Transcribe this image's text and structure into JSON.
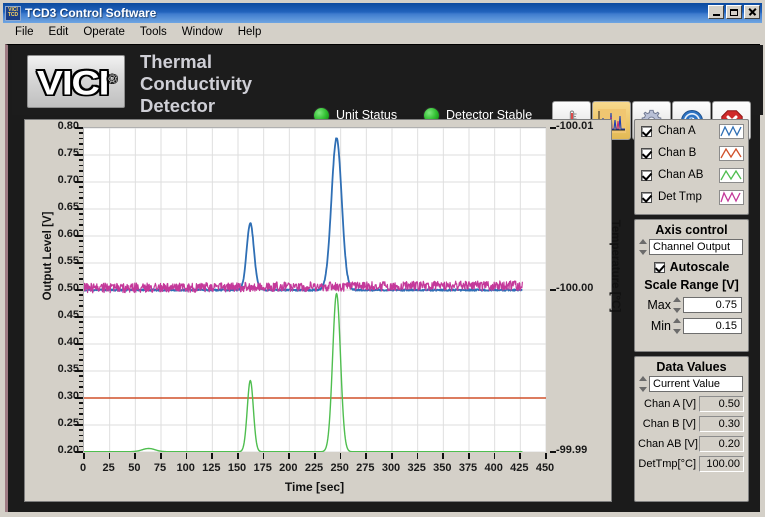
{
  "window": {
    "title": "TCD3 Control Software",
    "icon": "vici-tcd-icon",
    "minimize_label": "Minimize",
    "maximize_label": "Maximize",
    "close_label": "Close"
  },
  "menu": {
    "items": [
      {
        "label": "File"
      },
      {
        "label": "Edit"
      },
      {
        "label": "Operate"
      },
      {
        "label": "Tools"
      },
      {
        "label": "Window"
      },
      {
        "label": "Help"
      }
    ]
  },
  "banner": {
    "logo_text": "VICI",
    "logo_reg": "®",
    "product_title": "Thermal Conductivity Detector",
    "leds": [
      {
        "label": "Unit Status",
        "color": "#36c236"
      },
      {
        "label": "Detector Stable",
        "color": "#36c236"
      }
    ],
    "toolbar": [
      {
        "name": "temperature-button",
        "label": "Temperature"
      },
      {
        "name": "chromatogram-button",
        "label": "Chromatogram"
      },
      {
        "name": "settings-button",
        "label": "Settings"
      },
      {
        "name": "help-button",
        "label": "Help"
      },
      {
        "name": "close-app-button",
        "label": "Exit"
      }
    ]
  },
  "channels": {
    "items": [
      {
        "label": "Chan A",
        "checked": true,
        "color": "#2f6fb5"
      },
      {
        "label": "Chan B",
        "checked": true,
        "color": "#d1512a"
      },
      {
        "label": "Chan AB",
        "checked": true,
        "color": "#4fbe4f"
      },
      {
        "label": "Det Tmp",
        "checked": true,
        "color": "#c4399a"
      }
    ]
  },
  "axis_control": {
    "title": "Axis control",
    "selector_value": "Channel Output",
    "autoscale_label": "Autoscale",
    "autoscale_checked": true,
    "scale_range_label": "Scale Range [V]",
    "max_label": "Max",
    "max_value": "0.75",
    "min_label": "Min",
    "min_value": "0.15"
  },
  "data_values": {
    "title": "Data Values",
    "selector_value": "Current Value",
    "rows": [
      {
        "label": "Chan A [V]",
        "value": "0.50"
      },
      {
        "label": "Chan B [V]",
        "value": "0.30"
      },
      {
        "label": "Chan AB [V]",
        "value": "0.20"
      },
      {
        "label": "DetTmp[°C]",
        "value": "100.00"
      }
    ]
  },
  "chart_data": {
    "type": "line",
    "title": "",
    "xlabel": "Time [sec]",
    "ylabel": "Output Level [V]",
    "y2label": "Temperature [°C]",
    "xlim": [
      0,
      450
    ],
    "ylim": [
      0.2,
      0.8
    ],
    "y2lim": [
      -99.99,
      -100.01
    ],
    "xticks": [
      0,
      25,
      50,
      75,
      100,
      125,
      150,
      175,
      200,
      225,
      250,
      275,
      300,
      325,
      350,
      375,
      400,
      425,
      450
    ],
    "yticks": [
      0.2,
      0.25,
      0.3,
      0.35,
      0.4,
      0.45,
      0.5,
      0.55,
      0.6,
      0.65,
      0.7,
      0.75,
      0.8
    ],
    "y2ticks": [
      -100.01,
      -100.0,
      -99.99
    ],
    "grid": true,
    "legend_position": "external-right",
    "series": [
      {
        "name": "Chan A",
        "color": "#2f6fb5",
        "axis": "left",
        "baseline": 0.5,
        "peaks": [
          {
            "center": 162,
            "height": 0.124,
            "width": 5.0
          },
          {
            "center": 246,
            "height": 0.281,
            "width": 7.0
          }
        ],
        "data_end": 427,
        "noise": 0.0015
      },
      {
        "name": "Chan B",
        "color": "#d1512a",
        "axis": "left",
        "baseline": 0.3,
        "peaks": [],
        "data_end": 450,
        "noise": 0.0
      },
      {
        "name": "Chan AB",
        "color": "#4fbe4f",
        "axis": "left",
        "baseline": 0.2005,
        "peaks": [
          {
            "center": 63,
            "height": 0.006,
            "width": 9.0
          },
          {
            "center": 162,
            "height": 0.132,
            "width": 4.2
          },
          {
            "center": 246,
            "height": 0.293,
            "width": 5.4
          }
        ],
        "data_end": 427,
        "noise": 0.0
      },
      {
        "name": "Det Tmp",
        "color": "#c4399a",
        "axis": "right",
        "baseline": 0.5055,
        "peaks": [],
        "data_end": 427,
        "noise": 0.009,
        "drift": [
          {
            "x": 0,
            "y": 0.5035
          },
          {
            "x": 120,
            "y": 0.505
          },
          {
            "x": 250,
            "y": 0.5065
          },
          {
            "x": 427,
            "y": 0.508
          }
        ]
      }
    ]
  }
}
